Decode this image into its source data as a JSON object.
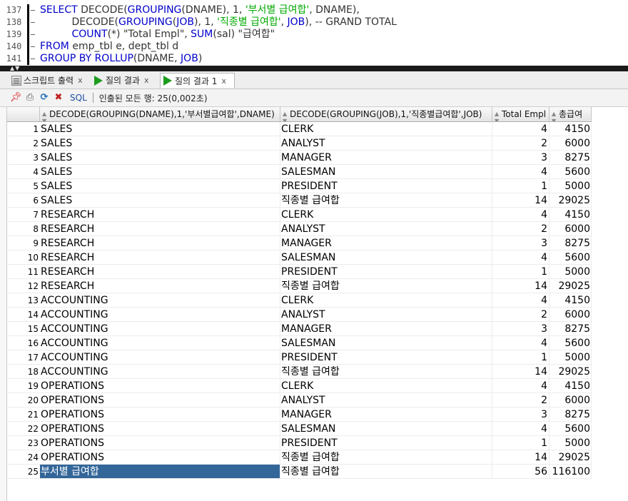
{
  "editor": {
    "line_numbers": [
      "137",
      "138",
      "139",
      "140",
      "141"
    ],
    "lines": [
      [
        {
          "t": "SELECT ",
          "c": "kw"
        },
        {
          "t": "DECODE(",
          "c": ""
        },
        {
          "t": "GROUPING",
          "c": "kw"
        },
        {
          "t": "(DNAME), 1, ",
          "c": ""
        },
        {
          "t": "'부서별 급여합'",
          "c": "str"
        },
        {
          "t": ", DNAME),",
          "c": ""
        }
      ],
      [
        {
          "t": "          DECODE(",
          "c": ""
        },
        {
          "t": "GROUPING",
          "c": "kw"
        },
        {
          "t": "(",
          "c": ""
        },
        {
          "t": "JOB",
          "c": "kw"
        },
        {
          "t": "), 1, ",
          "c": ""
        },
        {
          "t": "'직종별 급여합'",
          "c": "str"
        },
        {
          "t": ", ",
          "c": ""
        },
        {
          "t": "JOB",
          "c": "kw"
        },
        {
          "t": "), -- GRAND TOTAL",
          "c": "cmt"
        }
      ],
      [
        {
          "t": "          ",
          "c": ""
        },
        {
          "t": "COUNT",
          "c": "kw"
        },
        {
          "t": "(*) \"Total Empl\", ",
          "c": ""
        },
        {
          "t": "SUM",
          "c": "kw"
        },
        {
          "t": "(sal) \"급여합\"",
          "c": ""
        }
      ],
      [
        {
          "t": "FROM ",
          "c": "kw"
        },
        {
          "t": "emp_tbl e, dept_tbl d",
          "c": ""
        }
      ],
      [
        {
          "t": "GROUP BY ROLLUP",
          "c": "kw"
        },
        {
          "t": "(DNAME, ",
          "c": ""
        },
        {
          "t": "JOB",
          "c": "kw"
        },
        {
          "t": ")",
          "c": ""
        }
      ]
    ]
  },
  "tabs": [
    {
      "label": "스크립트 출력",
      "close": "x",
      "icon": "script-icon"
    },
    {
      "label": "질의 결과",
      "close": "x",
      "icon": "run-icon"
    },
    {
      "label": "질의 결과 1",
      "close": "x",
      "icon": "run-icon"
    }
  ],
  "toolbar": {
    "sql_label": "SQL",
    "status": "인출된 모든 행: 25(0,002초)",
    "icons": [
      "pin-icon",
      "print-icon",
      "refresh-icon",
      "export-icon"
    ]
  },
  "grid": {
    "columns": [
      "DECODE(GROUPING(DNAME),1,'부서별급여합',DNAME)",
      "DECODE(GROUPING(JOB),1,'직종별급여합',JOB)",
      "Total Empl",
      "총급여"
    ],
    "rows": [
      [
        "1",
        "SALES",
        "CLERK",
        "4",
        "4150"
      ],
      [
        "2",
        "SALES",
        "ANALYST",
        "2",
        "6000"
      ],
      [
        "3",
        "SALES",
        "MANAGER",
        "3",
        "8275"
      ],
      [
        "4",
        "SALES",
        "SALESMAN",
        "4",
        "5600"
      ],
      [
        "5",
        "SALES",
        "PRESIDENT",
        "1",
        "5000"
      ],
      [
        "6",
        "SALES",
        "직종별 급여합",
        "14",
        "29025"
      ],
      [
        "7",
        "RESEARCH",
        "CLERK",
        "4",
        "4150"
      ],
      [
        "8",
        "RESEARCH",
        "ANALYST",
        "2",
        "6000"
      ],
      [
        "9",
        "RESEARCH",
        "MANAGER",
        "3",
        "8275"
      ],
      [
        "10",
        "RESEARCH",
        "SALESMAN",
        "4",
        "5600"
      ],
      [
        "11",
        "RESEARCH",
        "PRESIDENT",
        "1",
        "5000"
      ],
      [
        "12",
        "RESEARCH",
        "직종별 급여합",
        "14",
        "29025"
      ],
      [
        "13",
        "ACCOUNTING",
        "CLERK",
        "4",
        "4150"
      ],
      [
        "14",
        "ACCOUNTING",
        "ANALYST",
        "2",
        "6000"
      ],
      [
        "15",
        "ACCOUNTING",
        "MANAGER",
        "3",
        "8275"
      ],
      [
        "16",
        "ACCOUNTING",
        "SALESMAN",
        "4",
        "5600"
      ],
      [
        "17",
        "ACCOUNTING",
        "PRESIDENT",
        "1",
        "5000"
      ],
      [
        "18",
        "ACCOUNTING",
        "직종별 급여합",
        "14",
        "29025"
      ],
      [
        "19",
        "OPERATIONS",
        "CLERK",
        "4",
        "4150"
      ],
      [
        "20",
        "OPERATIONS",
        "ANALYST",
        "2",
        "6000"
      ],
      [
        "21",
        "OPERATIONS",
        "MANAGER",
        "3",
        "8275"
      ],
      [
        "22",
        "OPERATIONS",
        "SALESMAN",
        "4",
        "5600"
      ],
      [
        "23",
        "OPERATIONS",
        "PRESIDENT",
        "1",
        "5000"
      ],
      [
        "24",
        "OPERATIONS",
        "직종별 급여합",
        "14",
        "29025"
      ],
      [
        "25",
        "부서별 급여합",
        "직종별 급여합",
        "56",
        "116100"
      ]
    ],
    "selected_row": 25,
    "selection_color": "#336699"
  }
}
